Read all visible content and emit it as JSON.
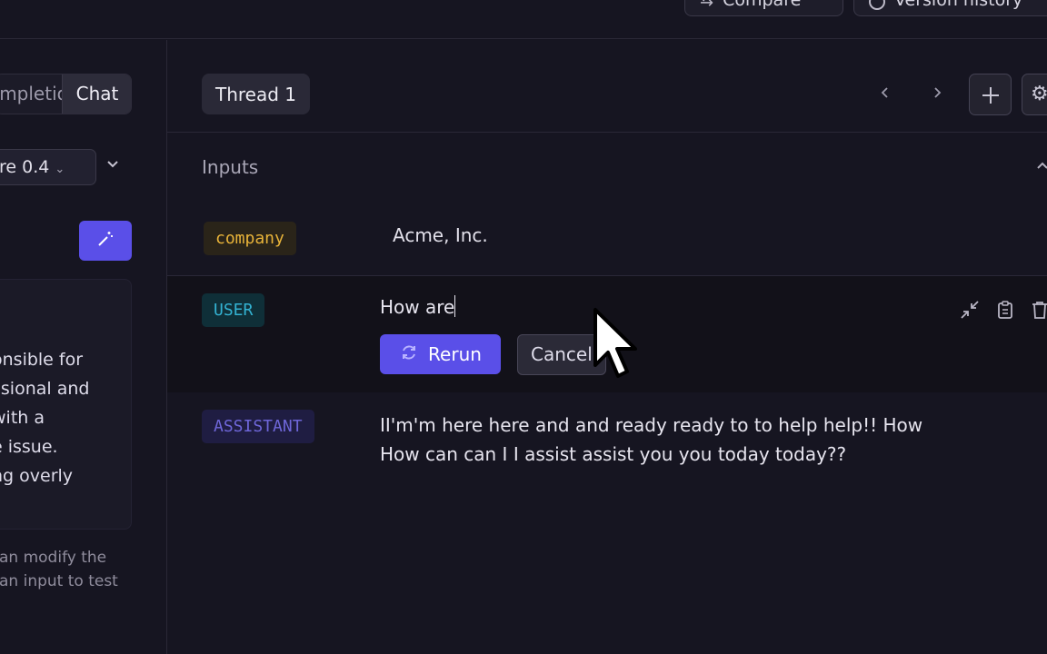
{
  "topbar": {
    "compare_label": "Compare",
    "version_history_label": "Version history"
  },
  "left": {
    "mode_tabs": [
      "Completion",
      "Chat"
    ],
    "model_label": "re 0.4",
    "system_text_lines": [
      "onsible for",
      "ssional and",
      "with a",
      "e issue.",
      "ng overly"
    ],
    "help_text_lines": [
      "an modify the",
      "an input to test"
    ]
  },
  "thread": {
    "tab_label": "Thread 1",
    "prev_icon": "chevron-left-icon",
    "next_icon": "chevron-right-icon",
    "add_icon": "plus-icon",
    "settings_icon": "gear-icon"
  },
  "inputs": {
    "section_label": "Inputs",
    "variables": [
      {
        "name": "company",
        "value": "Acme, Inc."
      }
    ]
  },
  "messages": {
    "user": {
      "role": "USER",
      "text": "How are",
      "rerun_label": "Rerun",
      "cancel_label": "Cancel"
    },
    "assistant": {
      "role": "ASSISTANT",
      "text": "II'm'm here here and and ready ready to to help help!! How How can can I I assist assist you you today today??"
    }
  },
  "colors": {
    "background": "#161521",
    "accent": "#5a4fe8",
    "company_chip_text": "#e8b339",
    "user_chip_text": "#33b2d2",
    "assistant_chip_text": "#6e66d8"
  }
}
